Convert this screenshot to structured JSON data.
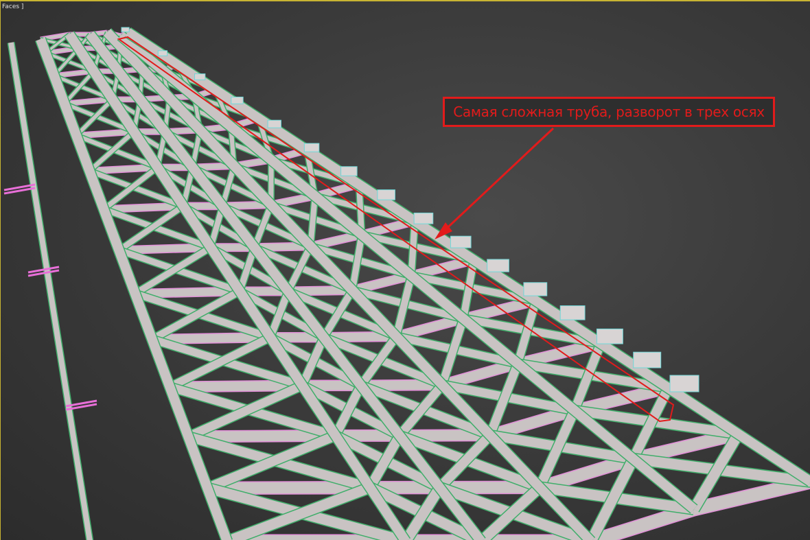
{
  "viewport": {
    "label": "Faces ]",
    "active_border_color": "#c8b432"
  },
  "annotation": {
    "text": "Самая сложная труба, разворот в трех осях",
    "color": "#e21b1b"
  },
  "colors": {
    "beam_fill": "#c9c3c3",
    "beam_edge": "#3fae6a",
    "cross_edge": "#e28fd8",
    "highlight": "#e21b1b"
  }
}
